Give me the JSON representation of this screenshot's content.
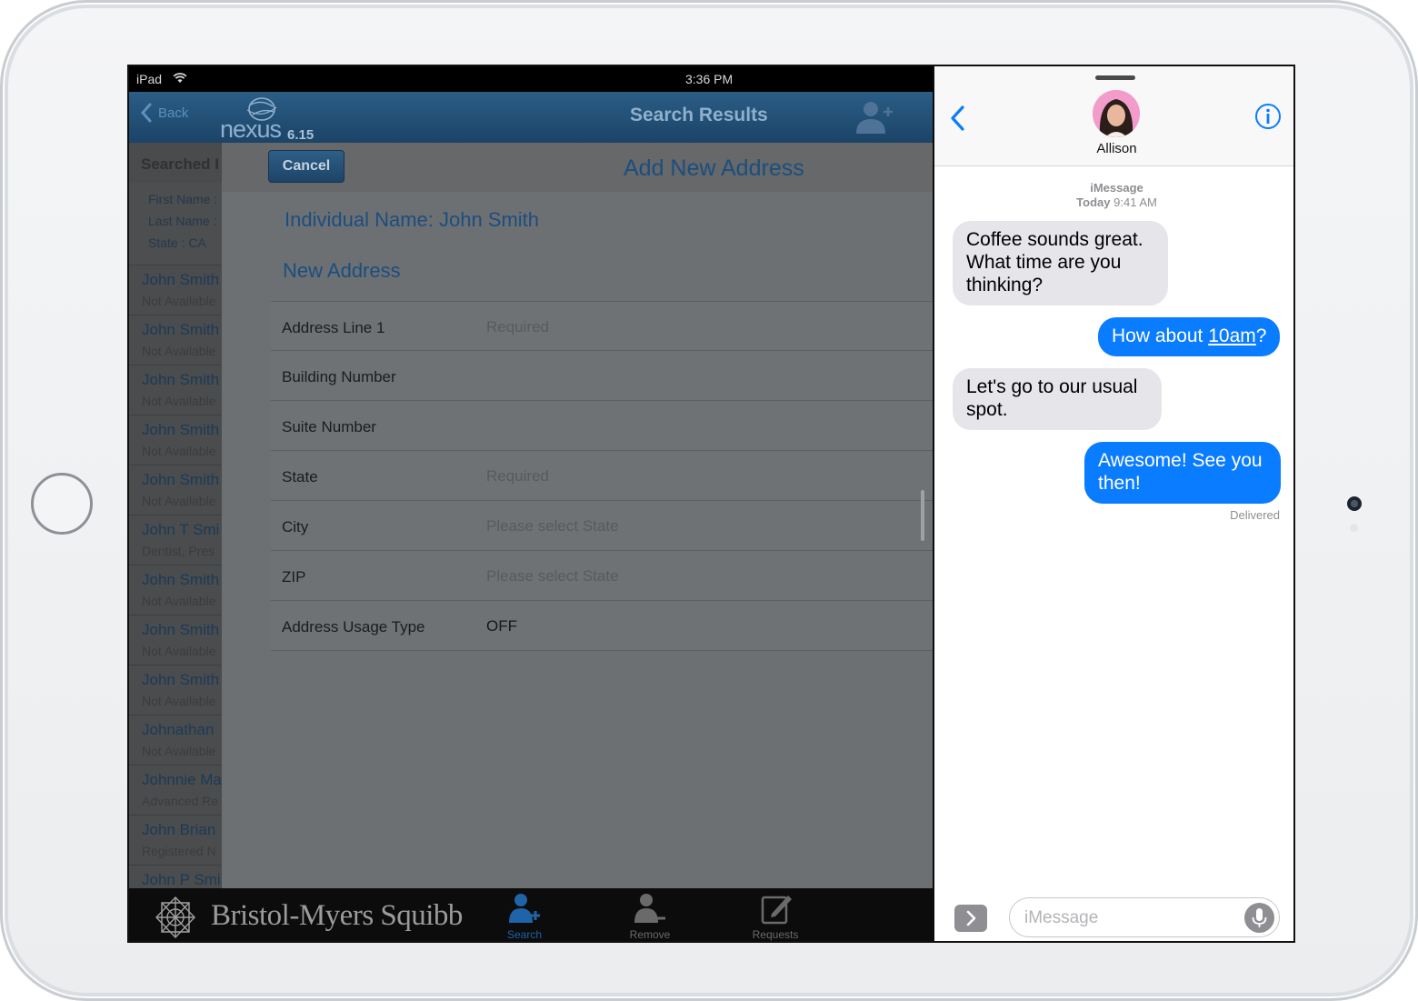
{
  "status_bar": {
    "carrier": "iPad",
    "time": "3:36 PM"
  },
  "nexus": {
    "nav": {
      "back_label": "Back",
      "logo_word": "nexus",
      "logo_version": "6.15",
      "title": "Search Results"
    },
    "search_panel": {
      "header": "Searched I",
      "criteria": [
        "First Name :",
        "Last Name :",
        "State : CA"
      ]
    },
    "results": [
      {
        "name": "John Smith",
        "detail": "Not Available"
      },
      {
        "name": "John Smith",
        "detail": "Not Available"
      },
      {
        "name": "John Smith",
        "detail": "Not Available"
      },
      {
        "name": "John Smith",
        "detail": "Not Available"
      },
      {
        "name": "John Smith",
        "detail": "Not Available"
      },
      {
        "name": "John T Smi",
        "detail": "Dentist, Pres"
      },
      {
        "name": "John Smith",
        "detail": "Not Available"
      },
      {
        "name": "John Smith",
        "detail": "Not Available"
      },
      {
        "name": "John Smith",
        "detail": "Not Available"
      },
      {
        "name": "Johnathan",
        "detail": "Not Available"
      },
      {
        "name": "Johnnie Ma",
        "detail": "Advanced Re"
      },
      {
        "name": "John Brian",
        "detail": "Registered N"
      },
      {
        "name": "John P Smi",
        "detail": ""
      }
    ],
    "modal": {
      "cancel_label": "Cancel",
      "title": "Add New Address",
      "individual_name": "Individual Name: John Smith",
      "section_title": "New Address",
      "fields": [
        {
          "label": "Address Line 1",
          "value": "Required"
        },
        {
          "label": "Building Number",
          "value": ""
        },
        {
          "label": "Suite Number",
          "value": ""
        },
        {
          "label": "State",
          "value": "Required"
        },
        {
          "label": "City",
          "value": "Please select State"
        },
        {
          "label": "ZIP",
          "value": "Please select State"
        },
        {
          "label": "Address Usage Type",
          "value": "OFF"
        }
      ]
    },
    "tabbar": {
      "brand": "Bristol-Myers Squibb",
      "tabs": [
        {
          "label": "Search",
          "icon": "search-user-icon",
          "active": true
        },
        {
          "label": "Remove",
          "icon": "remove-user-icon",
          "active": false
        },
        {
          "label": "Requests",
          "icon": "compose-icon",
          "active": false
        }
      ]
    }
  },
  "messages": {
    "contact": "Allison",
    "service": "iMessage",
    "day": "Today",
    "time": "9:41 AM",
    "bubbles": [
      {
        "dir": "in",
        "text": "Coffee sounds great. What time are you thinking?"
      },
      {
        "dir": "out",
        "text_before": "How about ",
        "link": "10am",
        "text_after": "?"
      },
      {
        "dir": "in",
        "text": "Let's go to our usual spot."
      },
      {
        "dir": "out",
        "text": "Awesome! See you then!"
      }
    ],
    "delivered": "Delivered",
    "input_placeholder": "iMessage",
    "colors": {
      "outgoing": "#0a7cff",
      "incoming": "#e5e5ea",
      "accent": "#0a7cff"
    }
  }
}
